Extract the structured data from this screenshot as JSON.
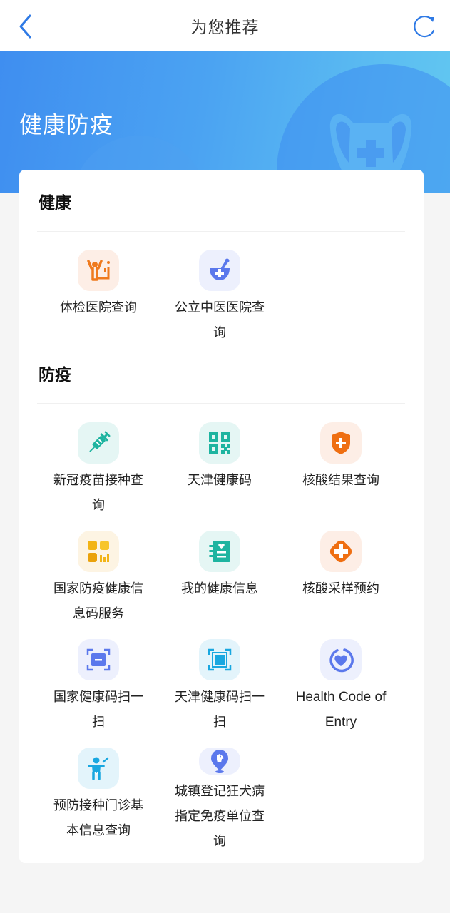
{
  "navbar": {
    "title": "为您推荐",
    "back_icon": "chevron-left-icon",
    "refresh_icon": "refresh-icon",
    "accent_color": "#2f7ae5"
  },
  "banner": {
    "title": "健康防疫",
    "decor_icon": "medical-mask-icon",
    "gradient_colors": [
      "#3f8ef0",
      "#62c8f1"
    ]
  },
  "sections": [
    {
      "title": "健康",
      "items": [
        {
          "label": "体检医院查询",
          "icon": "physical-exam-icon",
          "bg": "#fdeee6",
          "fg": "#ef7a1e"
        },
        {
          "label": "公立中医医院查询",
          "icon": "mortar-pestle-icon",
          "bg": "#edf0fd",
          "fg": "#5b78ec"
        }
      ]
    },
    {
      "title": "防疫",
      "items": [
        {
          "label": "新冠疫苗接种查询",
          "icon": "syringe-icon",
          "bg": "#e5f6f4",
          "fg": "#1eb4a0"
        },
        {
          "label": "天津健康码",
          "icon": "qr-code-icon",
          "bg": "#e5f6f4",
          "fg": "#1eb4a0"
        },
        {
          "label": "核酸结果查询",
          "icon": "shield-plus-icon",
          "bg": "#fdeee6",
          "fg": "#ef6f12"
        },
        {
          "label": "国家防疫健康信息码服务",
          "icon": "app-grid-icon",
          "bg": "#fdf4e3",
          "fg": "#f2b416"
        },
        {
          "label": "我的健康信息",
          "icon": "health-notebook-icon",
          "bg": "#e5f6f4",
          "fg": "#1eb4a0"
        },
        {
          "label": "核酸采样预约",
          "icon": "plus-diamond-icon",
          "bg": "#fdeee6",
          "fg": "#ef6f12"
        },
        {
          "label": "国家健康码扫一扫",
          "icon": "scan-frame-icon",
          "bg": "#edf0fd",
          "fg": "#5b78ec"
        },
        {
          "label": "天津健康码扫一扫",
          "icon": "scan-square-icon",
          "bg": "#e3f4fb",
          "fg": "#19a7e0"
        },
        {
          "label": "Health Code of Entry",
          "icon": "heart-ring-icon",
          "bg": "#edf0fd",
          "fg": "#5b78ec"
        },
        {
          "label": "预防接种门诊基本信息查询",
          "icon": "child-vaccine-icon",
          "bg": "#e3f4fb",
          "fg": "#19a7e0"
        },
        {
          "label": "城镇登记狂犬病指定免疫单位查询",
          "icon": "dog-location-pin-icon",
          "bg": "#edf0fd",
          "fg": "#5b78ec"
        }
      ]
    }
  ]
}
